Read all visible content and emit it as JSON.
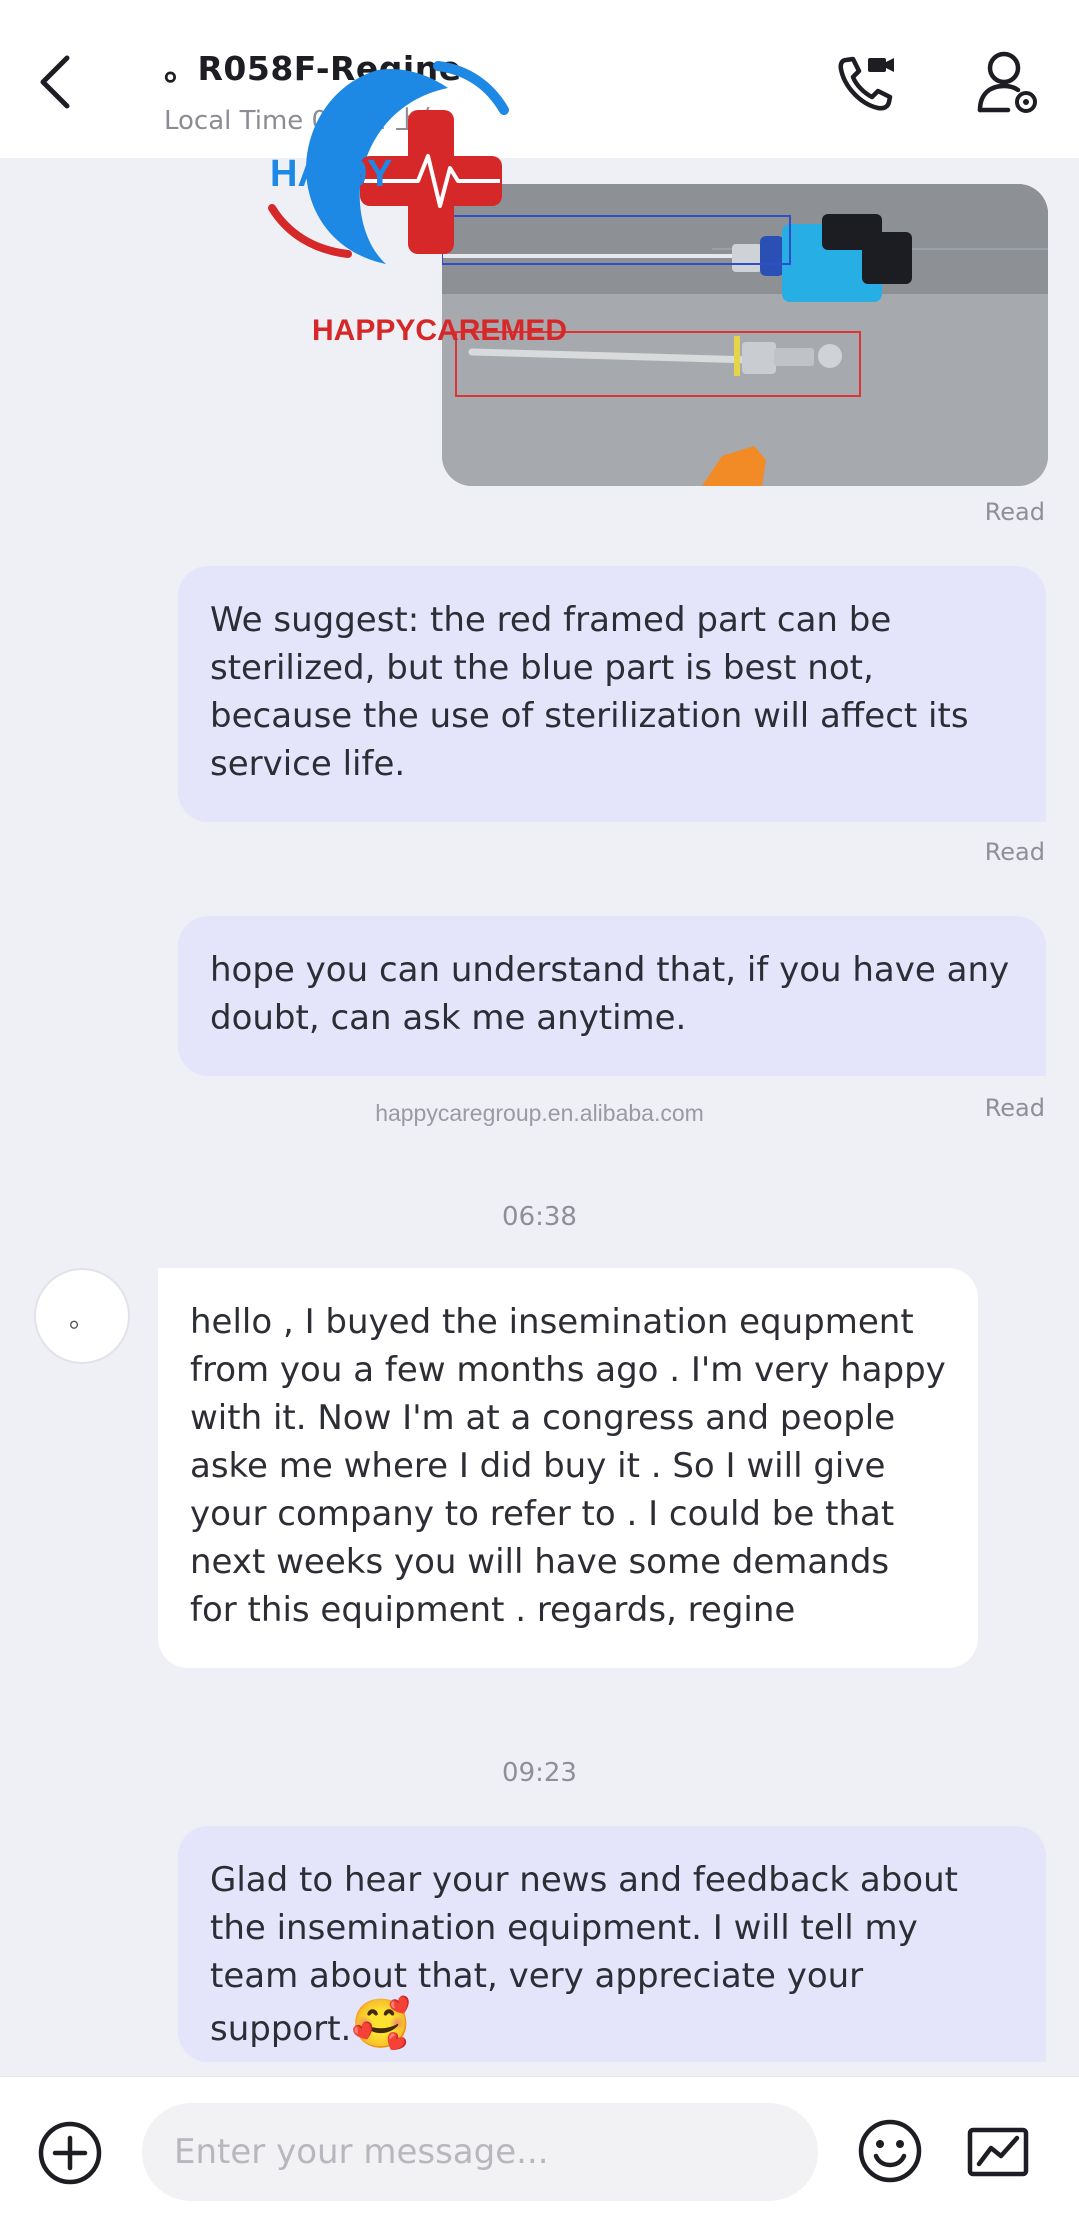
{
  "header": {
    "contact_name": "。R058F-Regine",
    "local_time": "Local Time 02:42 上午"
  },
  "watermark": {
    "logo_text": "HA99Y",
    "brand_text": "HAPPYCAREMED",
    "url": "happycaregroup.en.alibaba.com"
  },
  "messages": [
    {
      "type": "image",
      "direction": "out",
      "status": "Read"
    },
    {
      "type": "text",
      "direction": "out",
      "text": "We suggest: the red framed part can be sterilized, but the blue part is best not, because the use of sterilization will affect its service life.",
      "status": "Read"
    },
    {
      "type": "text",
      "direction": "out",
      "text": "hope you can understand that, if you have any doubt, can ask me anytime.",
      "status": "Read"
    },
    {
      "type": "time",
      "text": "06:38"
    },
    {
      "type": "text",
      "direction": "in",
      "avatar": "。",
      "text": "hello , I buyed the insemination equpment from you a few months ago . I'm very happy with it. Now I'm at a congress and people aske me where I did buy it . So I will give your company to refer to . I could be that next weeks you will have some demands for this equipment . regards, regine"
    },
    {
      "type": "time",
      "text": "09:23"
    },
    {
      "type": "text",
      "direction": "out",
      "text": "Glad to hear your news and feedback about the insemination equipment. I will tell my team about that, very appreciate your support.",
      "emoji": "🥰"
    }
  ],
  "input": {
    "placeholder": "Enter your message..."
  },
  "icons": {
    "back": "chevron-left-icon",
    "call": "video-call-icon",
    "profile": "user-settings-icon",
    "plus": "plus-circle-icon",
    "emoji": "smiley-icon",
    "quick": "quick-reply-icon"
  },
  "colors": {
    "outgoing_bubble": "#e4e5fb",
    "incoming_bubble": "#ffffff",
    "background": "#eef0f6",
    "red_frame": "#e03434",
    "blue_frame": "#2f4ec8",
    "logo_red": "#d62828",
    "logo_blue": "#1e88e5"
  }
}
